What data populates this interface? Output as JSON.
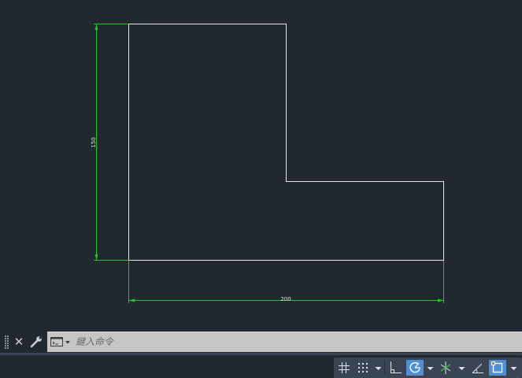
{
  "drawing": {
    "dimension_vertical": "150",
    "dimension_horizontal": "200",
    "geometry_color": "#e6e6e6",
    "dimension_color": "#1ec81e"
  },
  "command_line": {
    "placeholder": "鍵入命令"
  },
  "status_bar": {
    "grid_active": false,
    "snap_active": false,
    "ortho_active": false,
    "polar_active": true,
    "isodraft_active": false,
    "object_snap_tracking_active": false,
    "object_snap_active": true,
    "accent_color": "#4f8fd6"
  }
}
